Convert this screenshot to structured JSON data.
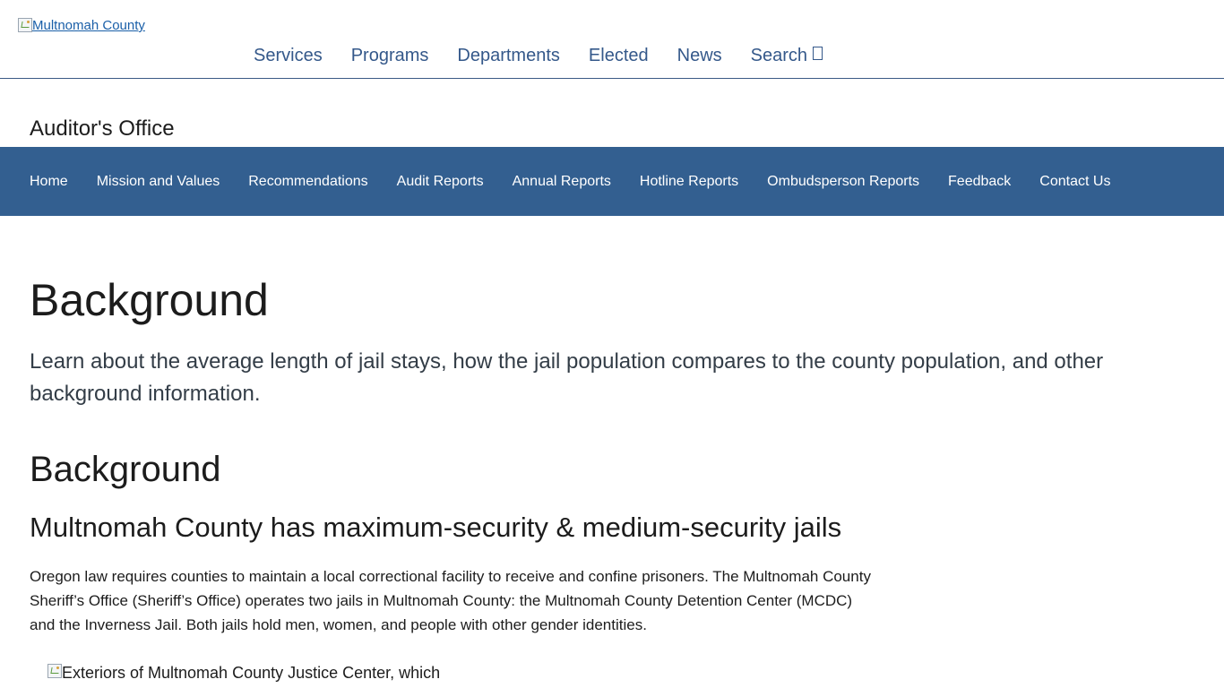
{
  "header": {
    "logo_alt": "Multnomah County",
    "nav": [
      "Services",
      "Programs",
      "Departments",
      "Elected",
      "News",
      "Search"
    ]
  },
  "section": {
    "title": "Auditor's Office",
    "nav": [
      "Home",
      "Mission and Values",
      "Recommendations",
      "Audit Reports",
      "Annual Reports",
      "Hotline Reports",
      "Ombudsperson Reports",
      "Feedback",
      "Contact Us"
    ]
  },
  "content": {
    "title": "Background",
    "lead": "Learn about the average length of jail stays, how the jail population compares to the county population, and other background information.",
    "heading": "Background",
    "subheading": "Multnomah County has maximum-security & medium-security jails",
    "paragraph": "Oregon law requires counties to maintain a local correctional facility to receive and confine prisoners. The Multnomah County Sheriff’s Office (Sheriff’s Office) operates two jails in Multnomah County: the Multnomah County Detention Center (MCDC) and the Inverness Jail. Both jails hold men, women, and people with other gender identities.",
    "image_alt": "Exteriors of Multnomah County Justice Center, which"
  },
  "colors": {
    "nav_band": "#335f90",
    "nav_link": "#34588a",
    "logo_link": "#1a5fa8"
  }
}
